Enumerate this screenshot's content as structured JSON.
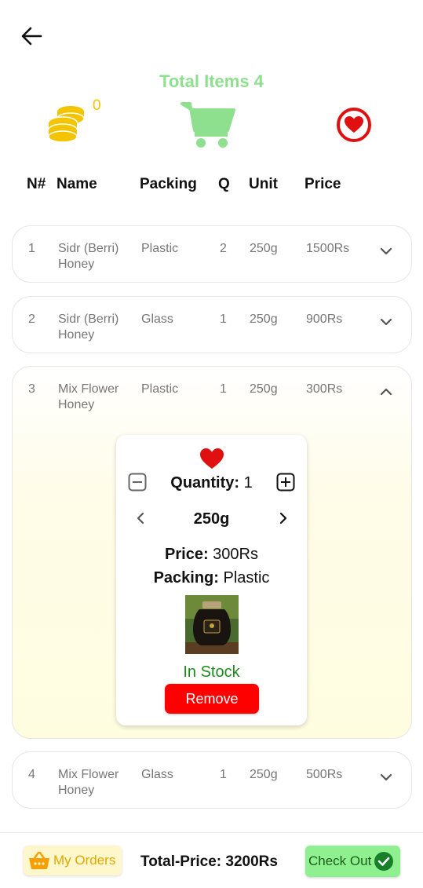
{
  "header": {
    "total_items_label": "Total Items 4",
    "coins_count": "0"
  },
  "columns": {
    "num": "N#",
    "name": "Name",
    "packing": "Packing",
    "q": "Q",
    "unit": "Unit",
    "price": "Price"
  },
  "rows": [
    {
      "num": "1",
      "name_line1": "Sidr (Berri)",
      "name_line2": "Honey",
      "packing": "Plastic",
      "q": "2",
      "unit": "250g",
      "price": "1500Rs",
      "expanded": false
    },
    {
      "num": "2",
      "name_line1": "Sidr (Berri)",
      "name_line2": "Honey",
      "packing": "Glass",
      "q": "1",
      "unit": "250g",
      "price": "900Rs",
      "expanded": false
    },
    {
      "num": "3",
      "name_line1": "Mix Flower",
      "name_line2": "Honey",
      "packing": "Plastic",
      "q": "1",
      "unit": "250g",
      "price": "300Rs",
      "expanded": true
    },
    {
      "num": "4",
      "name_line1": "Mix Flower",
      "name_line2": "Honey",
      "packing": "Glass",
      "q": "1",
      "unit": "250g",
      "price": "500Rs",
      "expanded": false
    }
  ],
  "detail": {
    "quantity_label": "Quantity:",
    "quantity_value": "1",
    "unit": "250g",
    "price_label": "Price:",
    "price_value": "300Rs",
    "packing_label": "Packing:",
    "packing_value": "Plastic",
    "stock_status": "In Stock",
    "remove_label": "Remove"
  },
  "footer": {
    "my_orders_label": "My Orders",
    "total_price_label": "Total-Price: 3200Rs",
    "checkout_label": "Check Out"
  },
  "colors": {
    "accent_green": "#8ee08e",
    "coin_yellow": "#f2c500",
    "heart_red": "#e01010",
    "remove_red": "#ff0000",
    "stock_green": "#1e8a1e"
  }
}
